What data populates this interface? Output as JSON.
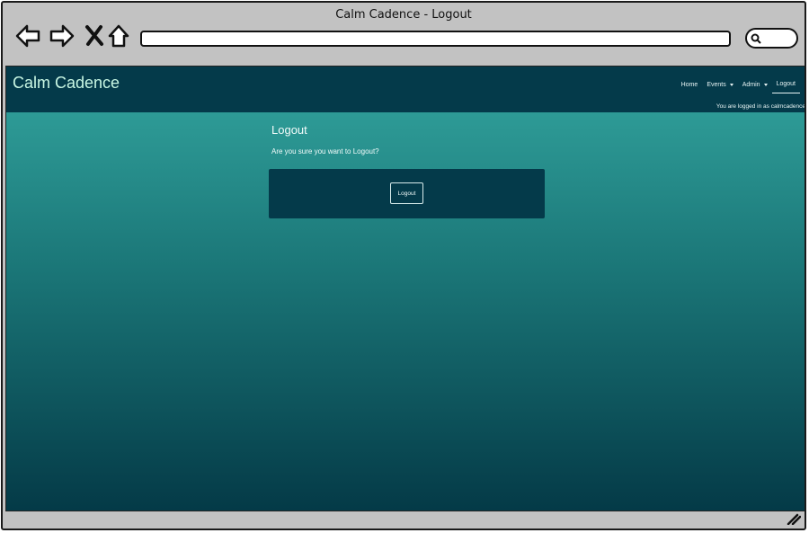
{
  "window": {
    "title": "Calm Cadence - Logout"
  },
  "toolbar": {
    "back_icon": "back-arrow-icon",
    "forward_icon": "forward-arrow-icon",
    "stop_icon": "close-icon",
    "home_icon": "home-icon",
    "url": "",
    "search_icon": "search-icon"
  },
  "site": {
    "brand": "Calm Cadence",
    "nav": [
      {
        "label": "Home"
      },
      {
        "label": "Events"
      },
      {
        "label": "Admin"
      },
      {
        "label": "Logout"
      }
    ],
    "logged_in_text": "You are logged in as calmcadence"
  },
  "main": {
    "title": "Logout",
    "confirm_text": "Are you sure you want to Logout?",
    "button_label": "Logout"
  },
  "colors": {
    "header": "#043a4a",
    "brand_text": "#c9f7e4",
    "gradient_top": "#33a59f",
    "gradient_bottom": "#043a47"
  }
}
